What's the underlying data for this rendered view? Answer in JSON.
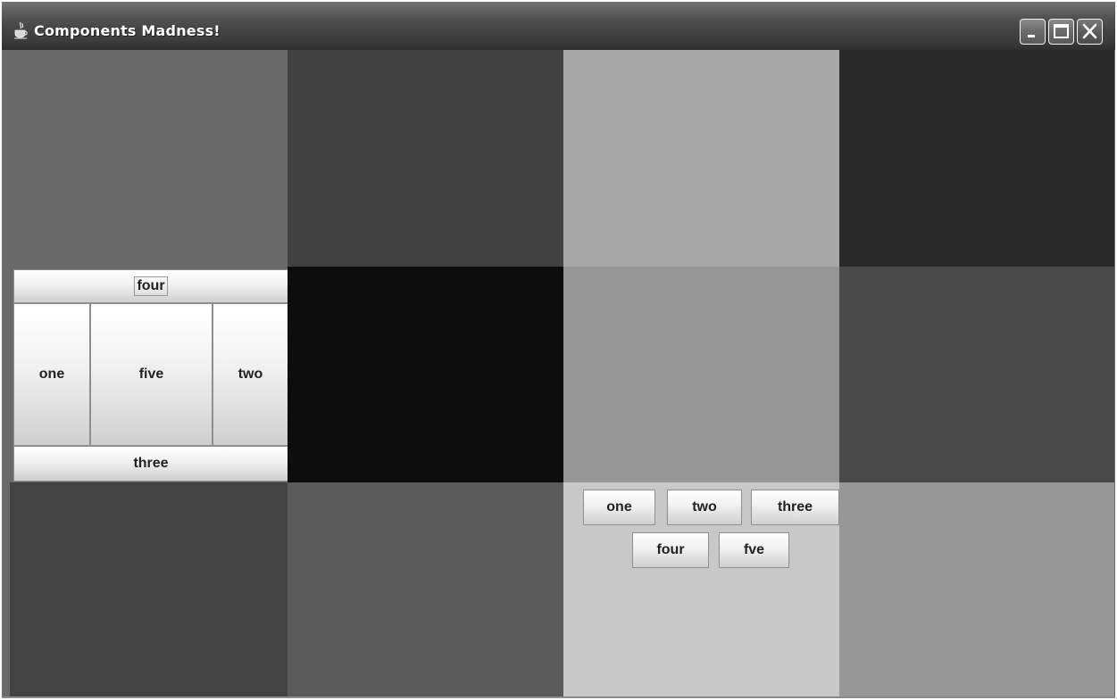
{
  "window": {
    "title": "Components Madness!",
    "icon": "java-cup-icon",
    "controls": {
      "minimize": "minimize-icon",
      "maximize": "maximize-icon",
      "close": "close-icon"
    }
  },
  "grid": {
    "cell_colors": [
      "#696969",
      "#414141",
      "#a7a7a7",
      "#292929",
      "#696969",
      "#0d0d0d",
      "#969696",
      "#4a4a4a",
      "#424242",
      "#5a5a5a",
      "#c8c8c8",
      "#979797"
    ]
  },
  "border_panel": {
    "north": "four",
    "west": "one",
    "center": "five",
    "east": "two",
    "south": "three"
  },
  "flow_panel": {
    "buttons": [
      "one",
      "two",
      "three",
      "four",
      "fve"
    ]
  }
}
